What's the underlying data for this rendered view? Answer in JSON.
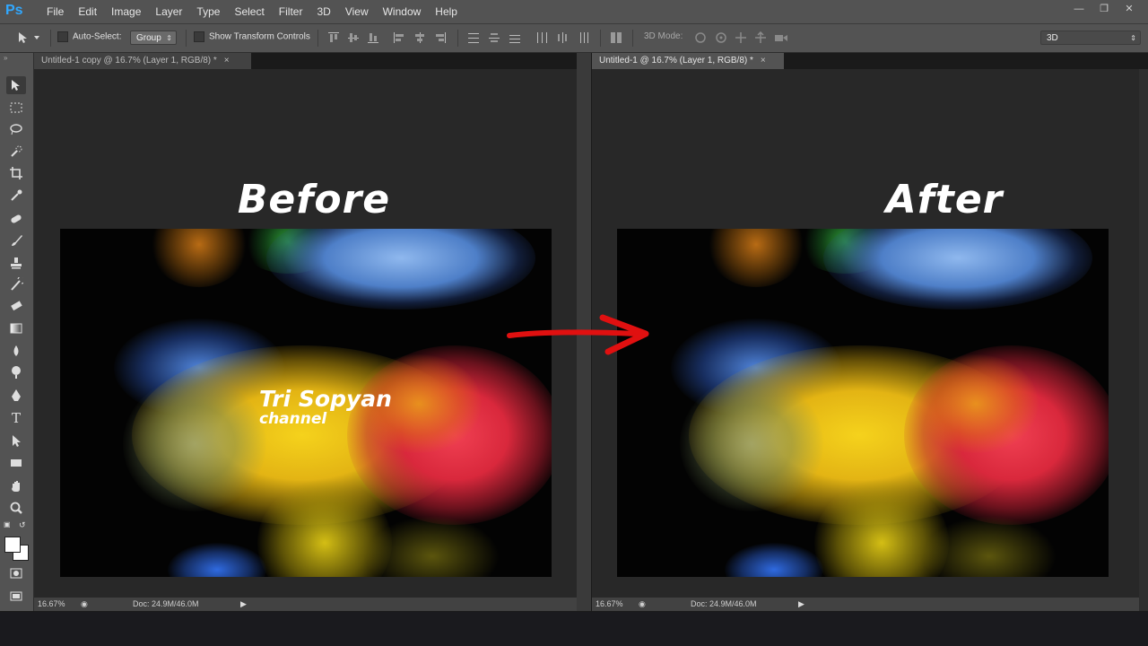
{
  "app": {
    "logo": "Ps"
  },
  "menu": [
    "File",
    "Edit",
    "Image",
    "Layer",
    "Type",
    "Select",
    "Filter",
    "3D",
    "View",
    "Window",
    "Help"
  ],
  "window_controls": [
    "minimize",
    "restore",
    "close"
  ],
  "options": {
    "auto_select_label": "Auto-Select:",
    "auto_select_value": "Group",
    "show_transform_label": "Show Transform Controls",
    "mode_label": "3D Mode:",
    "workspace_value": "3D"
  },
  "documents": [
    {
      "tab_title": "Untitled-1 copy @ 16.7% (Layer 1, RGB/8) *",
      "active": false,
      "banner": "Before",
      "watermark_line1": "Tri Sopyan",
      "watermark_line2": "channel",
      "zoom": "16.67%",
      "doc_info": "Doc: 24.9M/46.0M"
    },
    {
      "tab_title": "Untitled-1 @ 16.7% (Layer 1, RGB/8) *",
      "active": true,
      "banner": "After",
      "zoom": "16.67%",
      "doc_info": "Doc: 24.9M/46.0M"
    }
  ],
  "tools": [
    "move-tool",
    "marquee-tool",
    "lasso-tool",
    "quick-select-tool",
    "crop-tool",
    "eyedropper-tool",
    "healing-brush-tool",
    "brush-tool",
    "clone-stamp-tool",
    "history-brush-tool",
    "eraser-tool",
    "gradient-tool",
    "blur-tool",
    "dodge-tool",
    "pen-tool",
    "type-tool",
    "path-select-tool",
    "rectangle-tool",
    "hand-tool",
    "zoom-tool"
  ],
  "colors": {
    "accent": "#31a8ff",
    "arrow": "#e01010",
    "panel": "#535353",
    "canvas": "#282828"
  }
}
